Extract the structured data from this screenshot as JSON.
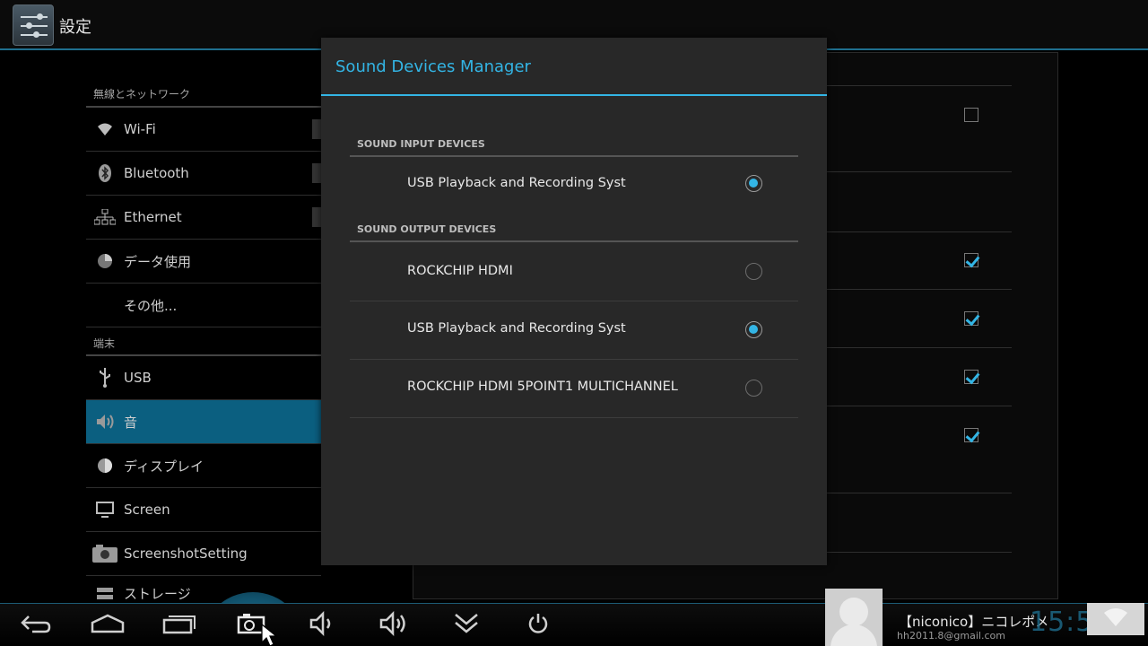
{
  "app": {
    "title": "設定"
  },
  "sidebar": {
    "sections": [
      {
        "label": "無線とネットワーク"
      },
      {
        "label": "端末"
      }
    ],
    "items": [
      {
        "label": "Wi-Fi",
        "icon": "wifi-icon"
      },
      {
        "label": "Bluetooth",
        "icon": "bluetooth-icon"
      },
      {
        "label": "Ethernet",
        "icon": "ethernet-icon"
      },
      {
        "label": "データ使用",
        "icon": "data-usage-icon"
      },
      {
        "label": "その他...",
        "icon": ""
      },
      {
        "label": "USB",
        "icon": "usb-icon"
      },
      {
        "label": "音",
        "icon": "sound-icon",
        "active": true
      },
      {
        "label": "ディスプレイ",
        "icon": "display-icon"
      },
      {
        "label": "Screen",
        "icon": "screen-icon"
      },
      {
        "label": "ScreenshotSetting",
        "icon": "camera-icon"
      },
      {
        "label": "ストレージ",
        "icon": "storage-icon"
      }
    ]
  },
  "dialog": {
    "title": "Sound Devices Manager",
    "input_section": "SOUND INPUT DEVICES",
    "output_section": "SOUND OUTPUT DEVICES",
    "input_devices": [
      {
        "label": "USB Playback and Recording Syst",
        "selected": true
      }
    ],
    "output_devices": [
      {
        "label": "ROCKCHIP HDMI",
        "selected": false
      },
      {
        "label": "USB Playback and Recording Syst",
        "selected": true
      },
      {
        "label": "ROCKCHIP HDMI 5POINT1 MULTICHANNEL",
        "selected": false
      }
    ]
  },
  "notification": {
    "title": "【niconico】ニコレポメ",
    "subtitle": "hh2011.8@gmail.com"
  },
  "status": {
    "clock": "15:53"
  },
  "colors": {
    "accent": "#33b5e5",
    "active_item": "#0b5f80"
  }
}
